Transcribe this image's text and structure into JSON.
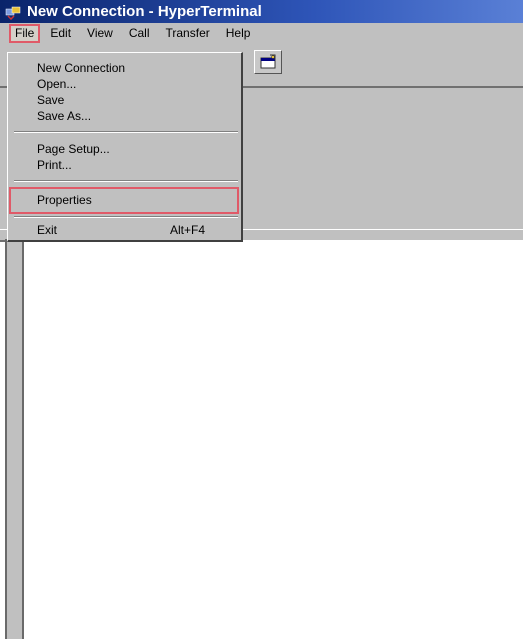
{
  "title": "New Connection - HyperTerminal",
  "menubar": {
    "items": [
      {
        "label": "File"
      },
      {
        "label": "Edit"
      },
      {
        "label": "View"
      },
      {
        "label": "Call"
      },
      {
        "label": "Transfer"
      },
      {
        "label": "Help"
      }
    ]
  },
  "toolbar": {
    "properties_icon": "properties-icon"
  },
  "file_menu": {
    "items": [
      {
        "label": "New Connection"
      },
      {
        "label": "Open..."
      },
      {
        "label": "Save"
      },
      {
        "label": "Save As..."
      },
      {
        "label": "Page Setup..."
      },
      {
        "label": "Print..."
      },
      {
        "label": "Properties"
      },
      {
        "label": "Exit",
        "shortcut": "Alt+F4"
      }
    ],
    "highlighted": "Properties"
  },
  "colors": {
    "titlebar": "#0a246a",
    "chrome": "#c0c0c0",
    "highlight_box": "#e05a68"
  }
}
